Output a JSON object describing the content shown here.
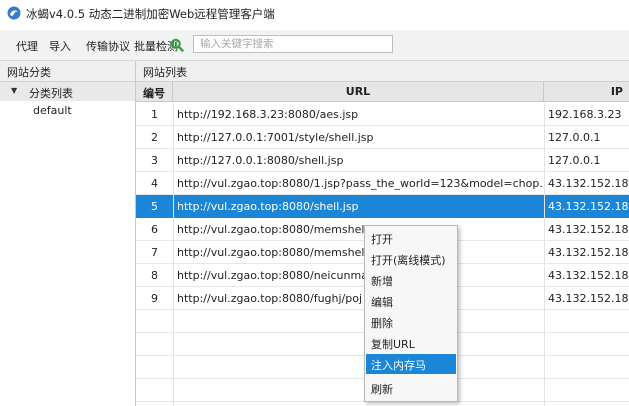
{
  "window": {
    "title": "冰蝎v4.0.5 动态二进制加密Web远程管理客户端",
    "app_icon": "scorpion-icon"
  },
  "toolbar": {
    "items": [
      "代理",
      "导入",
      "传输协议",
      "批量检测"
    ],
    "search_icon": "search-icon",
    "search_placeholder": "输入关键字搜索",
    "search_value": ""
  },
  "left_panel": {
    "header": "网站分类",
    "category_label": "分类列表",
    "category_expanded_icon": "triangle-down-icon",
    "leaf": "default"
  },
  "right_panel": {
    "header": "网站列表",
    "columns": [
      "编号",
      "URL",
      "IP"
    ],
    "rows": [
      {
        "num": "1",
        "url": "http://192.168.3.23:8080/aes.jsp",
        "ip": "192.168.3.23"
      },
      {
        "num": "2",
        "url": "http://127.0.0.1:7001/style/shell.jsp",
        "ip": "127.0.0.1"
      },
      {
        "num": "3",
        "url": "http://127.0.0.1:8080/shell.jsp",
        "ip": "127.0.0.1"
      },
      {
        "num": "4",
        "url": "http://vul.zgao.top:8080/1.jsp?pass_the_world=123&model=chop...",
        "ip": "43.132.152.18"
      },
      {
        "num": "5",
        "url": "http://vul.zgao.top:8080/shell.jsp",
        "ip": "43.132.152.18"
      },
      {
        "num": "6",
        "url": "http://vul.zgao.top:8080/memshell",
        "ip": "43.132.152.18"
      },
      {
        "num": "7",
        "url": "http://vul.zgao.top:8080/memshell",
        "ip": "43.132.152.18"
      },
      {
        "num": "8",
        "url": "http://vul.zgao.top:8080/neicunma",
        "ip": "43.132.152.18"
      },
      {
        "num": "9",
        "url": "http://vul.zgao.top:8080/fughj/poj",
        "ip": "43.132.152.18"
      }
    ],
    "selected_row": "5"
  },
  "context_menu": {
    "items": [
      "打开",
      "打开(离线模式)",
      "新增",
      "编辑",
      "删除",
      "复制URL",
      "注入内存马",
      "刷新"
    ],
    "highlighted": "注入内存马"
  },
  "colors": {
    "selection": "#1b86d8",
    "search_icon": "#22a83a"
  }
}
